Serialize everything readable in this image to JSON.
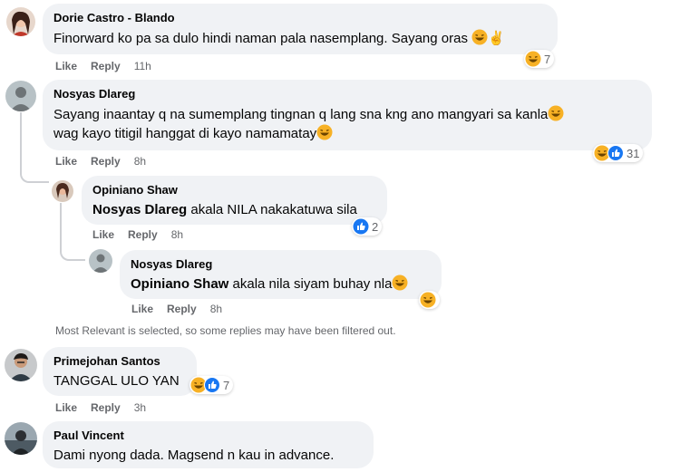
{
  "comments": [
    {
      "author": "Dorie Castro - Blando",
      "text": "Finorward ko pa sa dulo hindi naman pala nasemplang. Sayang oras",
      "actions": {
        "like": "Like",
        "reply": "Reply",
        "time": "11h"
      },
      "reactions": {
        "icons": [
          "haha-emoji"
        ],
        "count": "7"
      }
    },
    {
      "author": "Nosyas Dlareg",
      "text_line1": "Sayang inaantay q na sumemplang tingnan q lang sna kng ano mangyari sa kanla",
      "text_line2": "wag kayo titigil hanggat di kayo namamatay",
      "actions": {
        "like": "Like",
        "reply": "Reply",
        "time": "8h"
      },
      "reactions": {
        "icons": [
          "haha-emoji",
          "like-emoji"
        ],
        "count": "31"
      },
      "replies": [
        {
          "author": "Opiniano Shaw",
          "mention": "Nosyas Dlareg",
          "text": " akala NILA nakakatuwa sila",
          "actions": {
            "like": "Like",
            "reply": "Reply",
            "time": "8h"
          },
          "reactions": {
            "icons": [
              "like-emoji"
            ],
            "count": "2"
          }
        },
        {
          "author": "Nosyas Dlareg",
          "mention": "Opiniano Shaw",
          "text": " akala nila siyam buhay nla",
          "actions": {
            "like": "Like",
            "reply": "Reply",
            "time": "8h"
          },
          "reactions": {
            "icons": [
              "haha-emoji"
            ],
            "count": ""
          }
        }
      ]
    },
    {
      "author": "Primejohan Santos",
      "text": "TANGGAL ULO YAN",
      "actions": {
        "like": "Like",
        "reply": "Reply",
        "time": "3h"
      },
      "reactions": {
        "icons": [
          "haha-emoji",
          "like-emoji"
        ],
        "count": "7"
      }
    },
    {
      "author": "Paul Vincent",
      "text": "Dami nyong dada. Magsend n kau in advance."
    }
  ],
  "filter_notice": "Most Relevant is selected, so some replies may have been filtered out.",
  "colors": {
    "bubble": "#f0f2f5",
    "meta": "#65676b",
    "like_blue": "#1877f2",
    "haha_yellow": "#f7b125"
  }
}
